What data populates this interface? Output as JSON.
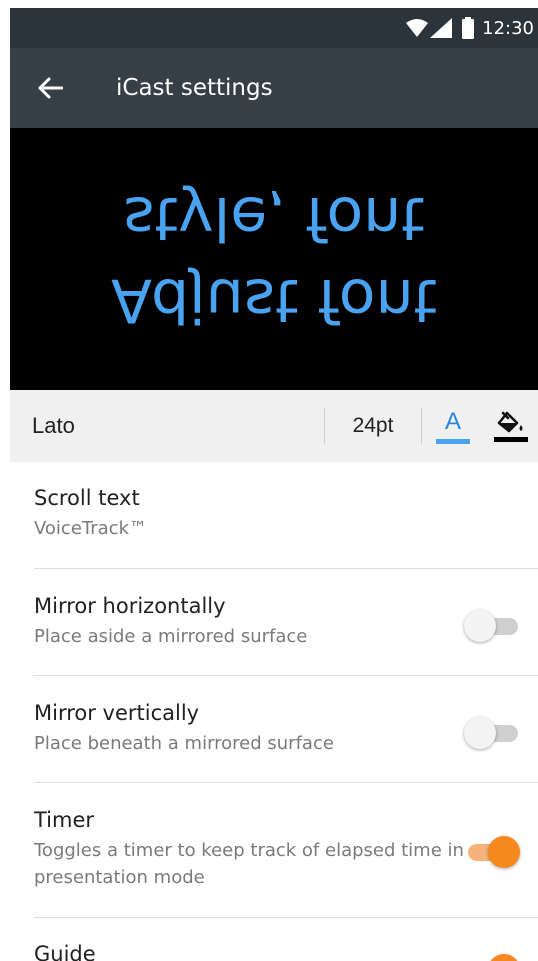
{
  "status_bar": {
    "time": "12:30"
  },
  "app_bar": {
    "title": "iCast settings"
  },
  "preview": {
    "line1": "Adjust font",
    "line2": "style, font",
    "text_color": "#4aa3f0",
    "background": "#000000",
    "mirrored": "vertical"
  },
  "font_bar": {
    "font_name": "Lato",
    "font_size": "24pt",
    "font_color_letter": "A",
    "font_color": "#4aa3f0",
    "background_color": "#000000"
  },
  "settings": [
    {
      "title": "Scroll text",
      "subtitle": "VoiceTrack™"
    },
    {
      "title": "Mirror horizontally",
      "subtitle": "Place aside a mirrored surface",
      "toggle": false
    },
    {
      "title": "Mirror vertically",
      "subtitle": "Place beneath a mirrored surface",
      "toggle": false
    },
    {
      "title": "Timer",
      "subtitle": "Toggles a timer to keep track of elapsed time in presentation mode",
      "toggle": true
    },
    {
      "title": "Guide",
      "toggle": true
    }
  ],
  "colors": {
    "accent": "#f5891f",
    "toolbar": "#363f45",
    "status_bar": "#2b343a"
  }
}
